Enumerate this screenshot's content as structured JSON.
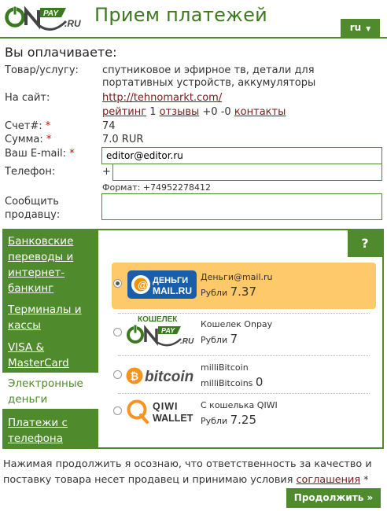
{
  "brand": {
    "logo_text_on": "ON",
    "logo_text_pay": "PAY",
    "logo_text_ru": ".RU"
  },
  "header": {
    "title": "Прием платежей",
    "lang": "ru"
  },
  "order": {
    "heading": "Вы оплачиваете:",
    "product_label": "Товар/услугу:",
    "product_line1": "спутниковое и эфирное тв, детали для",
    "product_line2": "портативных устройств, аккумуляторы",
    "site_label": "На сайт:",
    "site_url": "http://tehnomarkt.com/",
    "rating_link": "рейтинг",
    "rating_num": "1",
    "reviews_link": "отзывы",
    "rating_score": "+0 -0",
    "contacts_link": "контакты",
    "invoice_label": "Счет#:",
    "invoice_value": "74",
    "sum_label": "Сумма:",
    "sum_value": "7.0 RUR",
    "email_label": "Ваш E-mail:",
    "email_value": "editor@editor.ru",
    "phone_label": "Телефон:",
    "phone_prefix": "+",
    "phone_value": "",
    "phone_format": "Формат: +74952278412",
    "message_label1": "Сообщить",
    "message_label2": "продавцу:",
    "message_value": "",
    "required_mark": "*"
  },
  "menu": [
    {
      "line1": "Банковские",
      "line2": "переводы и",
      "line3": "интернет-",
      "line4": "банкинг"
    },
    {
      "line1": "Терминалы и",
      "line2": "кассы"
    },
    {
      "line1": "VISA &",
      "line2": "MasterCard"
    },
    {
      "line1": "Электронные",
      "line2": "деньги"
    },
    {
      "line1": "Платежи с",
      "line2": "телефона"
    }
  ],
  "help_label": "?",
  "methods": [
    {
      "logo_top": "ДЕНЬГИ",
      "logo_bottom": "MAIL.RU",
      "name": "Деньги@mail.ru",
      "currency": "Рубли",
      "price": "7.37",
      "selected": true
    },
    {
      "logo_top": "КОШЕЛЕК",
      "logo_on": "ON",
      "logo_pay": "PAY",
      "logo_ru": ".RU",
      "name": "Кошелек Onpay",
      "currency": "Рубли",
      "price": "7",
      "selected": false
    },
    {
      "logo_b": "₿",
      "logo_text": "bitcoin",
      "name": "milliBitcoin",
      "currency": "milliBitcoins",
      "price": "0",
      "selected": false
    },
    {
      "logo_top": "QIWI",
      "logo_bottom": "WALLET",
      "name": "С кошелька QIWI",
      "currency": "Рубли",
      "price": "7.25",
      "selected": false
    }
  ],
  "footer": {
    "notice_line1": "Нажимая продолжить я осознаю, что ответственность за качество и",
    "notice_line2": "поставку товара несет продавец и принимаю условия",
    "agreement_link": "соглашения",
    "notice_star": "*",
    "continue_label": "Продолжить »"
  },
  "colors": {
    "brand_green": "#4f8a2c",
    "selected_bg": "#fdc96a",
    "link": "#7a1a1a",
    "required": "#dd0000"
  }
}
